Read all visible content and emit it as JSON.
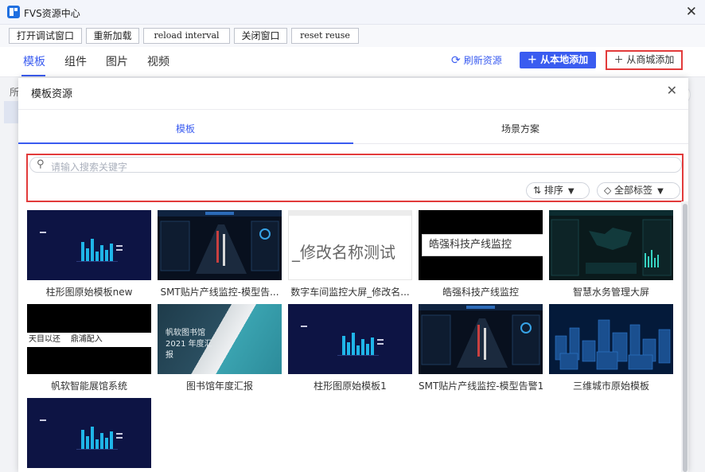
{
  "window": {
    "title": "FVS资源中心",
    "close_glyph": "✕"
  },
  "debug_toolbar": {
    "buttons": [
      "打开调试窗口",
      "重新加载",
      "reload interval",
      "关闭窗口",
      "reset reuse"
    ]
  },
  "tabs": [
    "模板",
    "组件",
    "图片",
    "视频"
  ],
  "actions": {
    "refresh": "刷新资源",
    "add_local": "从本地添加",
    "add_store": "从商城添加"
  },
  "behind": {
    "label": "所"
  },
  "modal": {
    "title": "模板资源",
    "close_glyph": "✕",
    "tabs": [
      "模板",
      "场景方案"
    ],
    "search_placeholder": "请输入搜索关键字",
    "sort_label": "排序",
    "tags_label": "全部标签"
  },
  "cards": [
    {
      "label": "柱形图原始模板new",
      "thumb": "dark-bar"
    },
    {
      "label": "SMT贴片产线监控-模型告...",
      "thumb": "monitor"
    },
    {
      "label": "数字车间监控大屏_修改名...",
      "thumb": "text",
      "thumb_text": "_修改名称测试"
    },
    {
      "label": "皓强科技产线监控",
      "thumb": "text-black",
      "thumb_text": "皓强科技产线监控"
    },
    {
      "label": "智慧水务管理大屏",
      "thumb": "water"
    },
    {
      "label": "帆软智能展馆系统",
      "thumb": "black-strip",
      "thumb_text": "天目以还    鼎浦配入"
    },
    {
      "label": "图书馆年度汇报",
      "thumb": "library",
      "thumb_text": "帆软图书馆 2021 年度汇报"
    },
    {
      "label": "柱形图原始模板1",
      "thumb": "dark-bar"
    },
    {
      "label": "SMT贴片产线监控-模型告警1",
      "thumb": "monitor"
    },
    {
      "label": "三维城市原始模板",
      "thumb": "city"
    },
    {
      "label": "",
      "thumb": "dark-bar"
    }
  ],
  "colors": {
    "accent": "#3a5cf0",
    "highlight": "#e23b3b"
  }
}
